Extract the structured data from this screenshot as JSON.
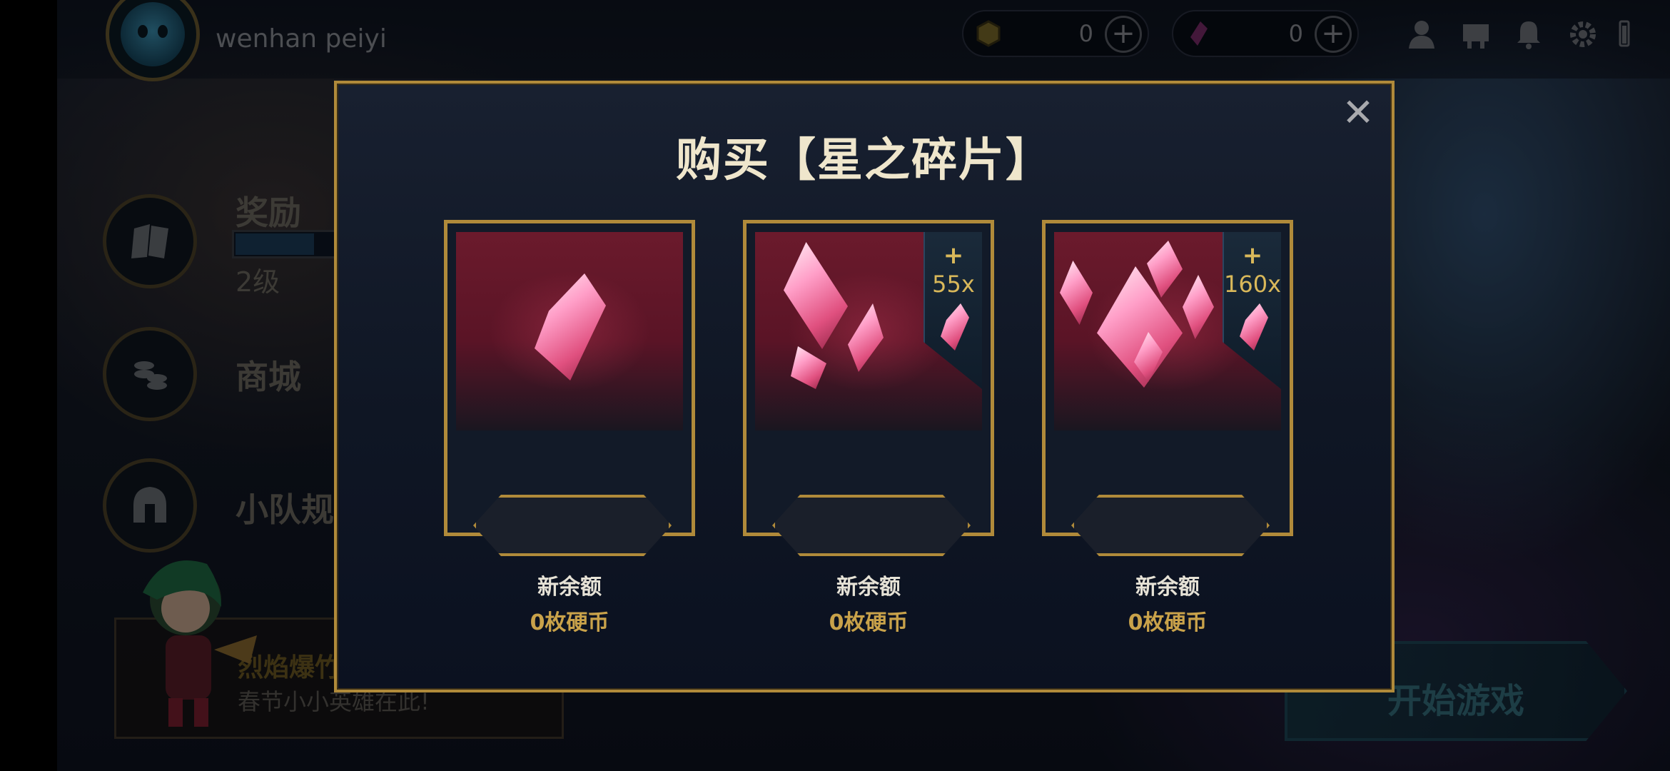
{
  "header": {
    "username": "wenhan peiyi",
    "currencies": [
      {
        "icon": "gold-coin-icon",
        "amount": "0"
      },
      {
        "icon": "star-shard-icon",
        "amount": "0"
      }
    ]
  },
  "menu": {
    "items": [
      {
        "label": "奖励",
        "icon": "cards-icon"
      },
      {
        "label": "商城",
        "icon": "coins-icon"
      },
      {
        "label": "小队规",
        "icon": "helmet-icon"
      }
    ],
    "level": "2级"
  },
  "event": {
    "title": "烈焰爆竹",
    "subtitle": "春节小小英雄在此!"
  },
  "play_button": "开始游戏",
  "modal": {
    "title": "购买【星之碎片】",
    "cards": [
      {
        "bonus_plus": "",
        "bonus_multiplier": "",
        "balance_label": "新余额",
        "balance_value": "0枚硬币"
      },
      {
        "bonus_plus": "+",
        "bonus_multiplier": "55x",
        "balance_label": "新余额",
        "balance_value": "0枚硬币"
      },
      {
        "bonus_plus": "+",
        "bonus_multiplier": "160x",
        "balance_label": "新余额",
        "balance_value": "0枚硬币"
      }
    ]
  },
  "colors": {
    "gold_border": "#b08a3a",
    "balance_value": "#c9a24a",
    "title": "#efe6cc"
  }
}
